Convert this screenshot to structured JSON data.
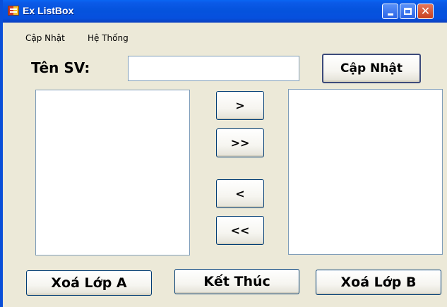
{
  "window": {
    "title": "Ex ListBox"
  },
  "menu": {
    "items": [
      "Cập Nhật",
      "Hệ Thống"
    ]
  },
  "form": {
    "name_label": "Tên SV:",
    "name_value": "",
    "update_button": "Cập Nhật",
    "list_a_items": [],
    "list_b_items": []
  },
  "transfer_buttons": {
    "move_one_right": ">",
    "move_all_right": ">>",
    "move_one_left": "<",
    "move_all_left": "<<"
  },
  "bottom_buttons": {
    "clear_a": "Xoá Lớp A",
    "exit": "Kết Thúc",
    "clear_b": "Xoá Lớp B"
  },
  "colors": {
    "titlebar": "#0553dd",
    "window_bg": "#ece9d8",
    "close_button": "#c8401f"
  },
  "icons": [
    "app-icon",
    "minimize-icon",
    "maximize-icon",
    "close-icon"
  ]
}
